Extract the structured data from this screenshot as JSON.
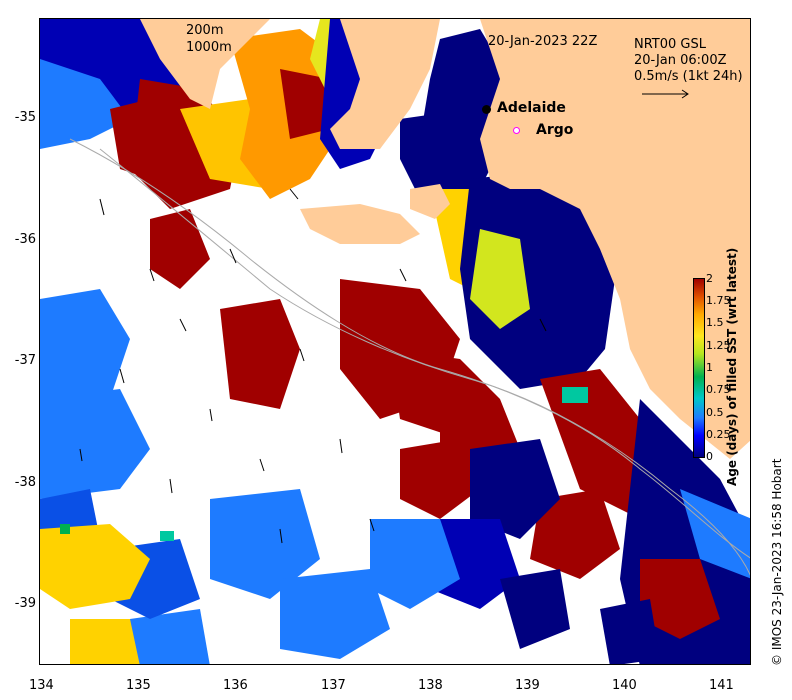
{
  "map": {
    "timestamp": "20-Jan-2023 22Z",
    "product": "NRT00 GSL",
    "current_time": "20-Jan 06:00Z",
    "current_scale": "0.5m/s (1kt 24h)",
    "isobath_shallow": "200m",
    "isobath_deep": "1000m",
    "places": [
      {
        "name": "Adelaide",
        "lon": 138.6,
        "lat": -34.93,
        "marker": "filled-circle"
      },
      {
        "name": "Argo",
        "lon": 138.8,
        "lat": -35.12,
        "marker": "open-circle-magenta"
      }
    ],
    "lon_range": [
      134,
      141.3
    ],
    "lat_range": [
      -39.5,
      -34.2
    ],
    "x_ticks": [
      "134",
      "135",
      "136",
      "137",
      "138",
      "139",
      "140",
      "141"
    ],
    "y_ticks": [
      "-35",
      "-36",
      "-37",
      "-38",
      "-39"
    ],
    "colorbar": {
      "title": "Age (days) of filled SST (wrt latest)",
      "ticks": [
        "2",
        "1.75",
        "1.5",
        "1.25",
        "1",
        "0.75",
        "0.5",
        "0.25",
        "0"
      ],
      "colors": [
        "#00007f",
        "#0000ff",
        "#1e7bff",
        "#00c8c8",
        "#00b050",
        "#b6e61e",
        "#ffe61e",
        "#ffaa00",
        "#e05000",
        "#a00000"
      ]
    },
    "land_color": "#ffcc99",
    "credit": "© IMOS 23-Jan-2023 16:58 Hobart"
  }
}
